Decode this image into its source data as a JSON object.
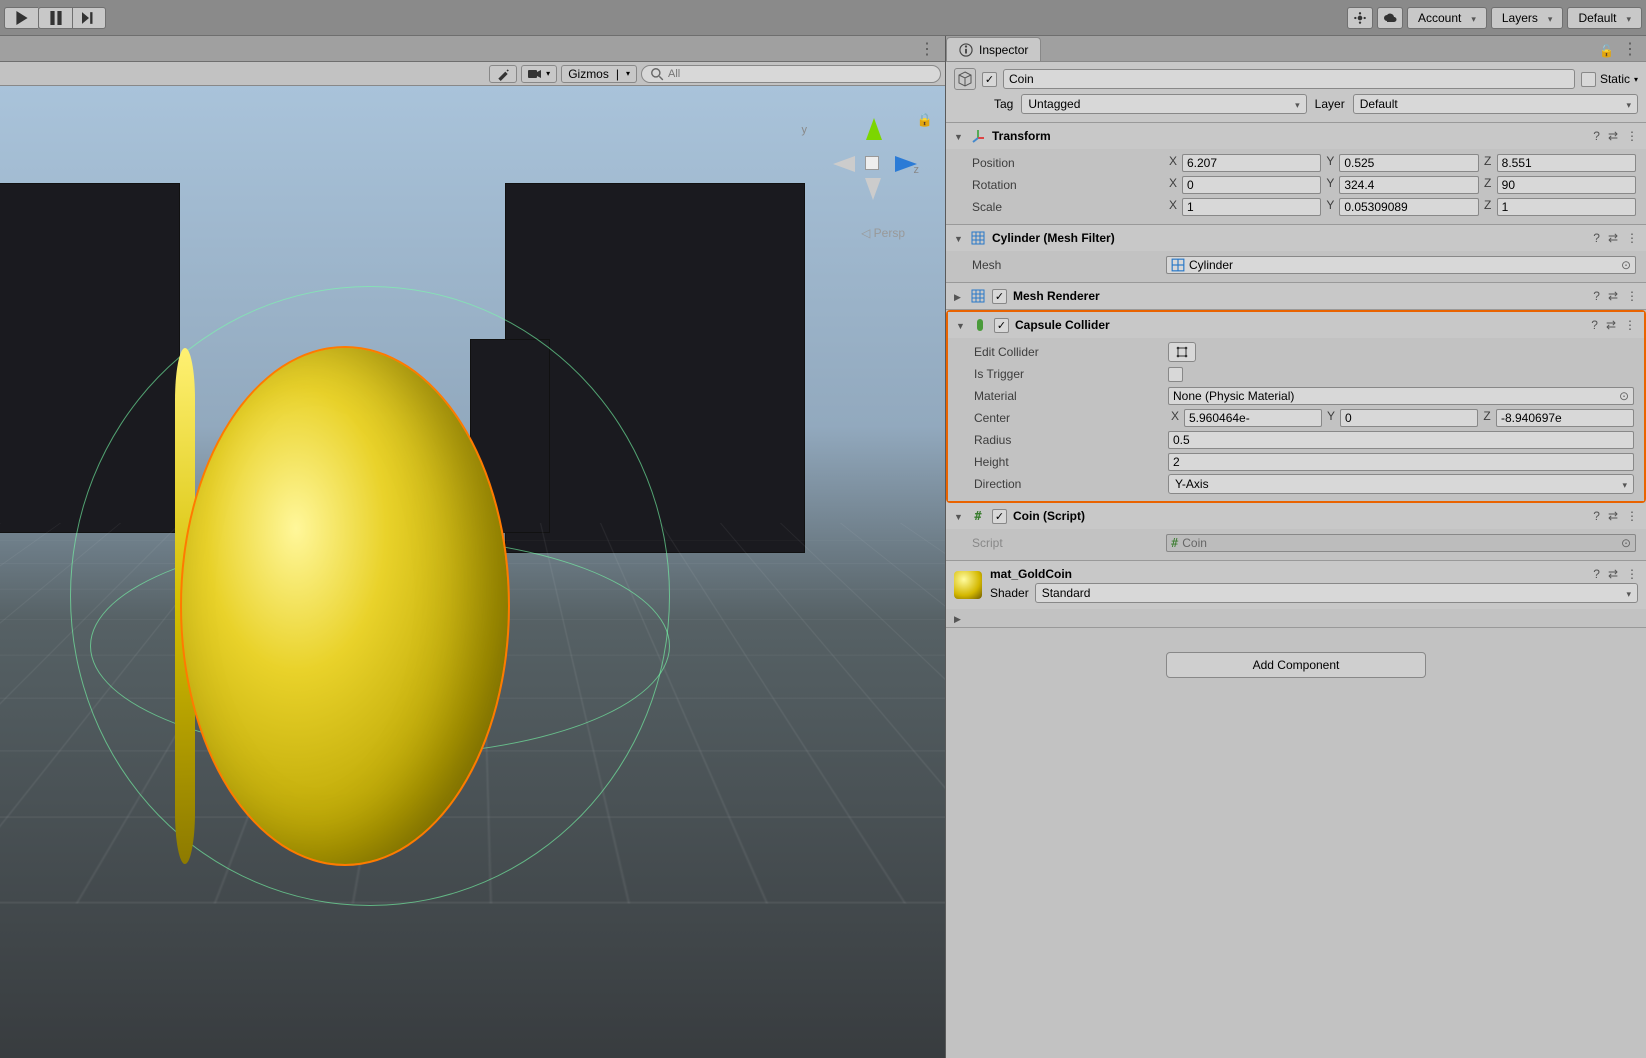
{
  "toolbar": {
    "account": "Account",
    "layers": "Layers",
    "default": "Default"
  },
  "scene": {
    "gizmos": "Gizmos",
    "search_placeholder": "All",
    "persp": "Persp",
    "axis_y": "y",
    "axis_z": "z"
  },
  "inspector": {
    "tab": "Inspector",
    "object_name": "Coin",
    "static": "Static",
    "tag_label": "Tag",
    "tag_value": "Untagged",
    "layer_label": "Layer",
    "layer_value": "Default",
    "transform": {
      "title": "Transform",
      "position": "Position",
      "rotation": "Rotation",
      "scale": "Scale",
      "pos": {
        "x": "6.207",
        "y": "0.525",
        "z": "8.551"
      },
      "rot": {
        "x": "0",
        "y": "324.4",
        "z": "90"
      },
      "scl": {
        "x": "1",
        "y": "0.05309089",
        "z": "1"
      }
    },
    "meshfilter": {
      "title": "Cylinder (Mesh Filter)",
      "mesh_label": "Mesh",
      "mesh_value": "Cylinder"
    },
    "meshrenderer": {
      "title": "Mesh Renderer"
    },
    "capsule": {
      "title": "Capsule Collider",
      "edit": "Edit Collider",
      "trigger": "Is Trigger",
      "material": "Material",
      "material_value": "None (Physic Material)",
      "center": "Center",
      "center_v": {
        "x": "5.960464e-",
        "y": "0",
        "z": "-8.940697e"
      },
      "radius": "Radius",
      "radius_v": "0.5",
      "height": "Height",
      "height_v": "2",
      "direction": "Direction",
      "direction_v": "Y-Axis"
    },
    "script": {
      "title": "Coin (Script)",
      "label": "Script",
      "value": "Coin"
    },
    "material": {
      "title": "mat_GoldCoin",
      "shader_label": "Shader",
      "shader_value": "Standard"
    },
    "add": "Add Component"
  }
}
